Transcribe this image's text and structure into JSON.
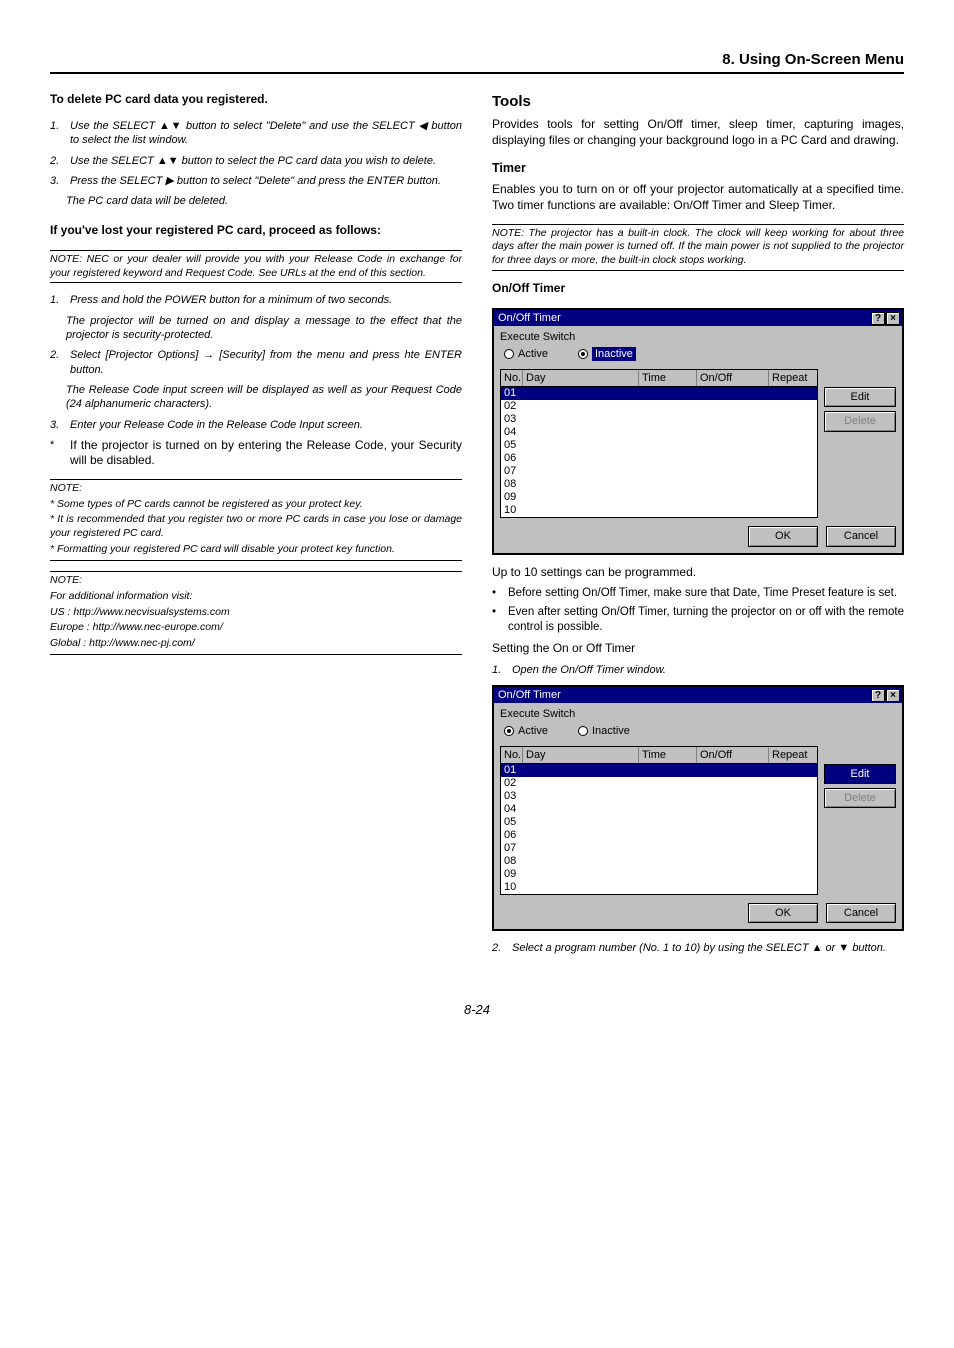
{
  "chapterTitle": "8. Using On-Screen Menu",
  "pageNumber": "8-24",
  "left": {
    "delHead": "To delete PC card data you registered.",
    "del1": "Use the SELECT ▲▼ button to select \"Delete\" and use the SELECT ◀ button to select the list window.",
    "del2": "Use the SELECT ▲▼ button to select the PC card data you wish to delete.",
    "del3": "Press the SELECT ▶ button to select \"Delete\" and press the ENTER button.",
    "delRes": "The PC card data will be deleted.",
    "lostHead": "If you've lost your registered PC card, proceed as follows:",
    "lostNote": "NOTE: NEC or your dealer will provide you with your Release Code in exchange for your registered keyword and Request Code. See URLs at the end of this section.",
    "lost1": "Press and hold the POWER button for a minimum of two seconds.",
    "lost1b": "The projector will be turned on and display a message to the effect that the projector is security-protected.",
    "lost2": "Select [Projector Options] → [Security] from the menu and press hte ENTER button.",
    "lost2b": "The Release Code input screen will be displayed as well as your Request Code (24 alphanumeric characters).",
    "lost3": "Enter your Release Code in the Release Code Input screen.",
    "lostStar": "If the projector is turned on by entering the Release Code, your Security will be disabled.",
    "note2a": "NOTE:",
    "note2b": "* Some types of PC cards cannot be registered as your protect key.",
    "note2c": "* It is recommended that you register two or more PC cards in case you lose or damage your registered PC card.",
    "note2d": "* Formatting your registered PC card will disable your protect key function.",
    "note3a": "NOTE:",
    "note3b": "For additional information visit:",
    "note3c": "US : http://www.necvisualsystems.com",
    "note3d": "Europe : http://www.nec-europe.com/",
    "note3e": "Global : http://www.nec-pj.com/"
  },
  "right": {
    "toolsTitle": "Tools",
    "toolsDesc": "Provides tools for setting On/Off timer, sleep timer, capturing images, displaying files or changing your background logo in a PC Card and drawing.",
    "timerTitle": "Timer",
    "timerDesc": "Enables you to turn on or off your projector automatically at a specified time. Two timer functions are available: On/Off Timer and Sleep Timer.",
    "timerNote": "NOTE: The projector has a built-in clock. The clock will keep working for about three days after the main power is turned off. If the main power is not supplied to the projector for three days or more, the built-in clock stops working.",
    "onOffTitle": "On/Off Timer",
    "upto": "Up to 10 settings can be programmed.",
    "bullet1": "Before setting On/Off Timer, make sure that Date, Time Preset feature is set.",
    "bullet2": "Even after setting On/Off Timer, turning the projector on or off with the remote control is possible.",
    "setHead": "Setting the On or Off Timer",
    "step1": "Open the On/Off Timer window.",
    "step2": "Select a program number (No. 1 to 10) by using the SELECT ▲ or ▼ button."
  },
  "dialog": {
    "title": "On/Off Timer",
    "execLabel": "Execute Switch",
    "active": "Active",
    "inactive": "Inactive",
    "hNo": "No.",
    "hDay": "Day",
    "hTime": "Time",
    "hOnOff": "On/Off",
    "hRepeat": "Repeat",
    "rows": [
      "01",
      "02",
      "03",
      "04",
      "05",
      "06",
      "07",
      "08",
      "09",
      "10"
    ],
    "edit": "Edit",
    "delete": "Delete",
    "ok": "OK",
    "cancel": "Cancel",
    "help": "?",
    "close": "×"
  }
}
